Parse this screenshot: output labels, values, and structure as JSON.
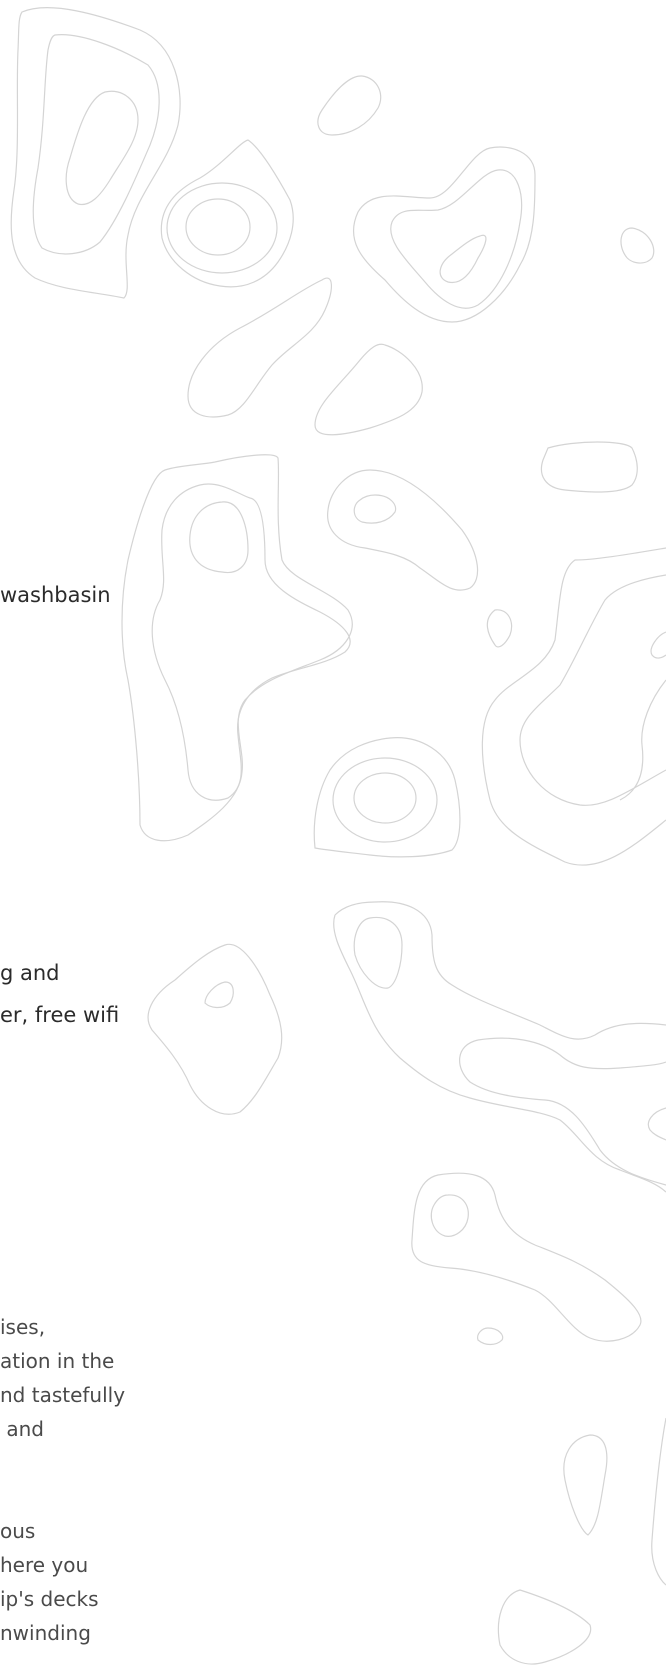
{
  "amenities": {
    "line1": "washbasin",
    "line2": "g and",
    "line3": "er, free wifi"
  },
  "description": {
    "para1": [
      "ises,",
      "ation in the",
      "nd tastefully",
      " and"
    ],
    "para2": [
      "ous",
      "here you",
      "ip's decks",
      "nwinding"
    ]
  },
  "background": {
    "pattern": "topographic-contour-lines",
    "stroke_color": "#d4d4d4",
    "page_color": "#ffffff"
  }
}
